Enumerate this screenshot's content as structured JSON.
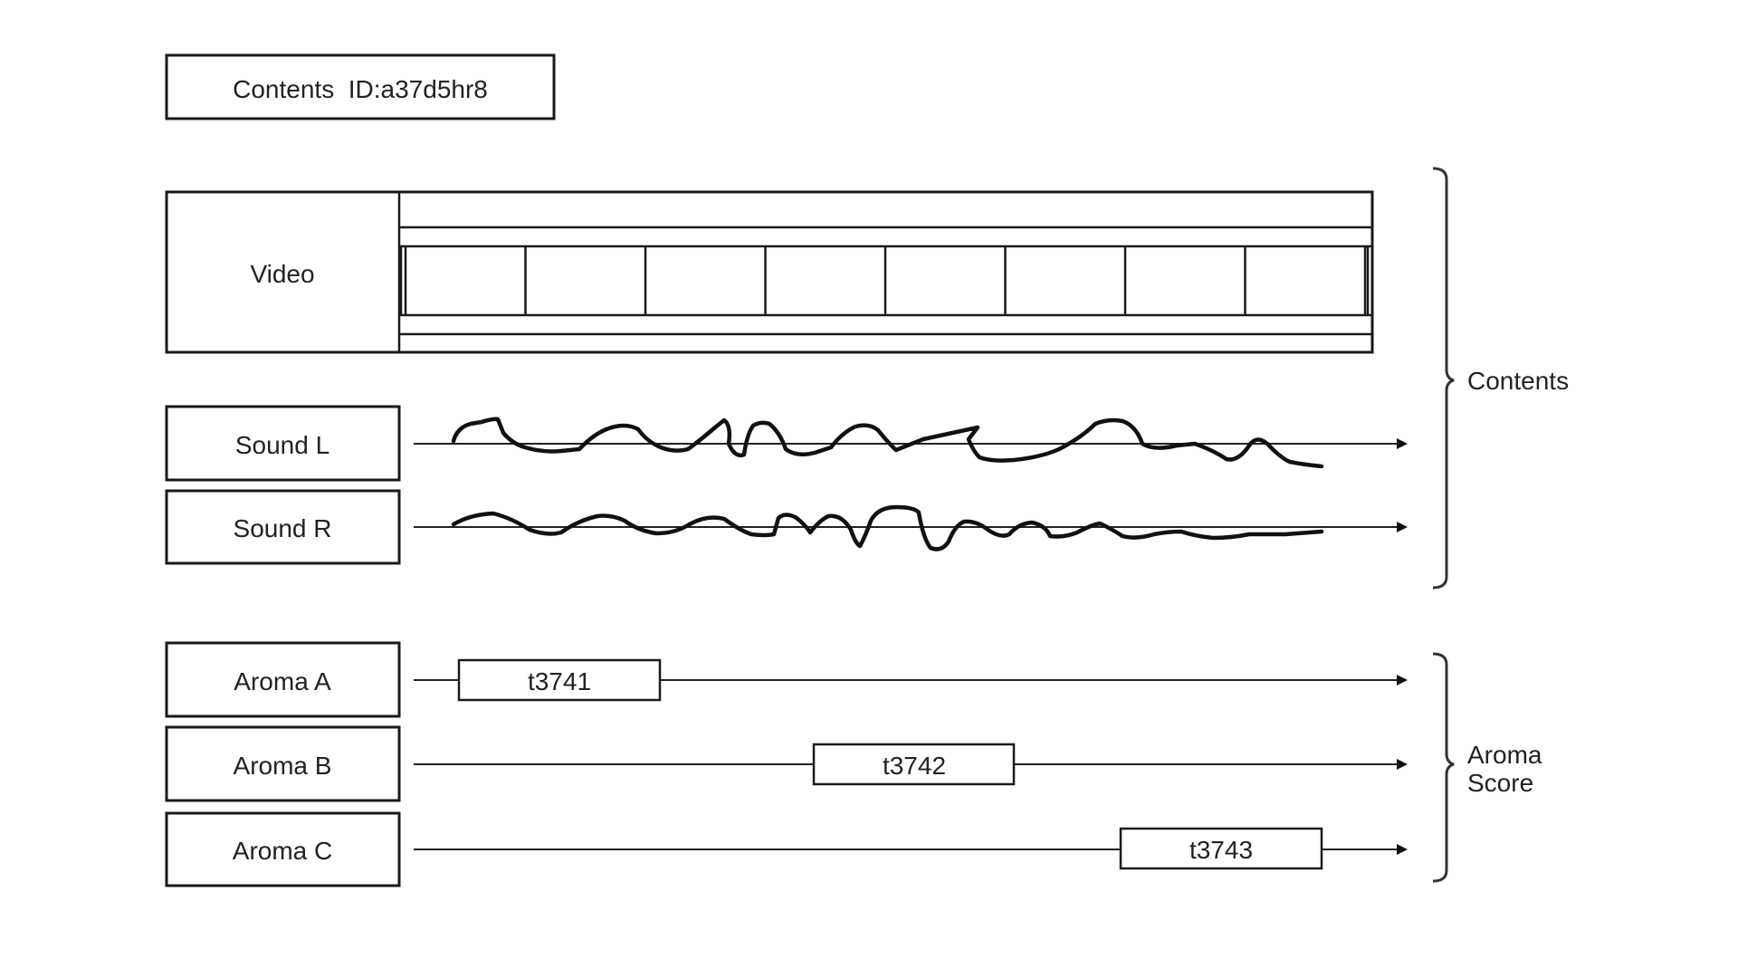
{
  "header": {
    "contents_id_label": "Contents  ID:a37d5hr8"
  },
  "tracks": {
    "video": {
      "label": "Video",
      "frame_count": 8,
      "frame_icon": "car-icon"
    },
    "sound_l": {
      "label": "Sound L"
    },
    "sound_r": {
      "label": "Sound R"
    },
    "aroma_a": {
      "label": "Aroma A",
      "segment_label": "t3741"
    },
    "aroma_b": {
      "label": "Aroma B",
      "segment_label": "t3742"
    },
    "aroma_c": {
      "label": "Aroma C",
      "segment_label": "t3743"
    }
  },
  "groups": {
    "contents": {
      "label": "Contents"
    },
    "aroma_score": {
      "label_line1": "Aroma",
      "label_line2": "Score"
    }
  },
  "colors": {
    "line": "#1a1a1a",
    "background": "#ffffff"
  }
}
